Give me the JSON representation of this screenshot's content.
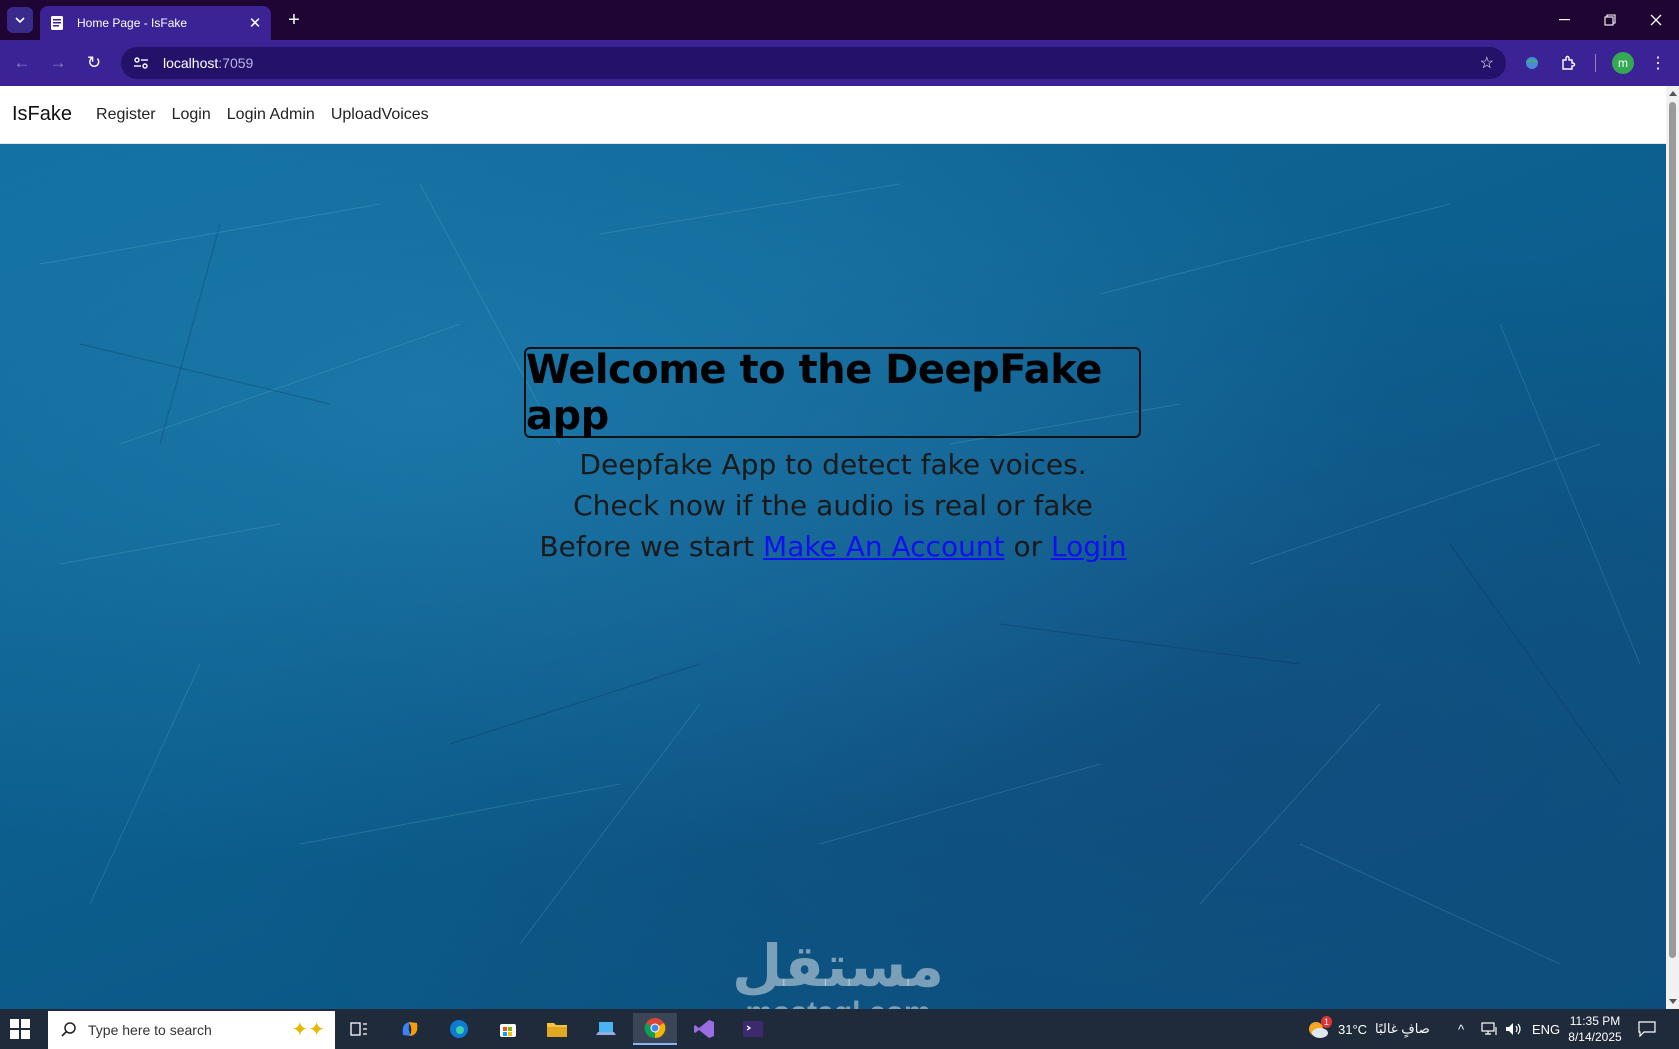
{
  "browser": {
    "tab_title": "Home Page - IsFake",
    "url_host": "localhost",
    "url_port": ":7059",
    "profile_initial": "m"
  },
  "site": {
    "brand": "IsFake",
    "nav": [
      "Register",
      "Login",
      "Login Admin",
      "UploadVoices"
    ]
  },
  "hero": {
    "heading": "Welcome to the DeepFake app",
    "line1": "Deepfake App to detect fake voices.",
    "line2": "Check now if the audio is real or fake",
    "line3_prefix": "Before we start",
    "make_account_link": "Make An Account",
    "or_text": "or",
    "login_link": "Login"
  },
  "watermark": {
    "arabic": "مستقل",
    "latin": "mostaql.com"
  },
  "taskbar": {
    "search_placeholder": "Type here to search",
    "weather_temp": "31°C",
    "weather_desc": "صافٍ غالبًا",
    "weather_badge": "1",
    "language": "ENG",
    "time": "11:35 PM",
    "date": "8/14/2025",
    "apps": [
      "task-view",
      "copilot",
      "edge",
      "store",
      "file-explorer",
      "laptop-app",
      "chrome",
      "visual-studio",
      "terminal"
    ]
  },
  "colors": {
    "tabstrip": "#1e0533",
    "toolbar": "#3b2396",
    "link": "#1010f0",
    "hero_bg": "#0c5f8e"
  }
}
